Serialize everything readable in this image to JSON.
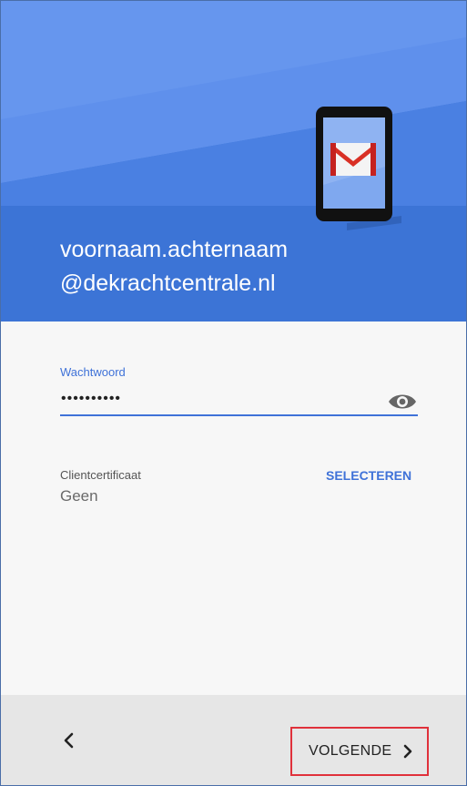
{
  "header": {
    "account_line1": "voornaam.achternaam",
    "account_line2": "@dekrachtcentrale.nl",
    "illustration": "gmail-tablet-icon"
  },
  "password": {
    "label": "Wachtwoord",
    "masked_value": "••••••••••",
    "toggle_icon": "eye-icon"
  },
  "certificate": {
    "label": "Clientcertificaat",
    "value": "Geen",
    "select_label": "SELECTEREN"
  },
  "footer": {
    "back_icon": "chevron-left-icon",
    "next_label": "VOLGENDE",
    "next_icon": "chevron-right-icon"
  },
  "colors": {
    "header_blue": "#3c74d6",
    "accent_blue": "#3f72d8",
    "highlight_red": "#e0313b"
  }
}
